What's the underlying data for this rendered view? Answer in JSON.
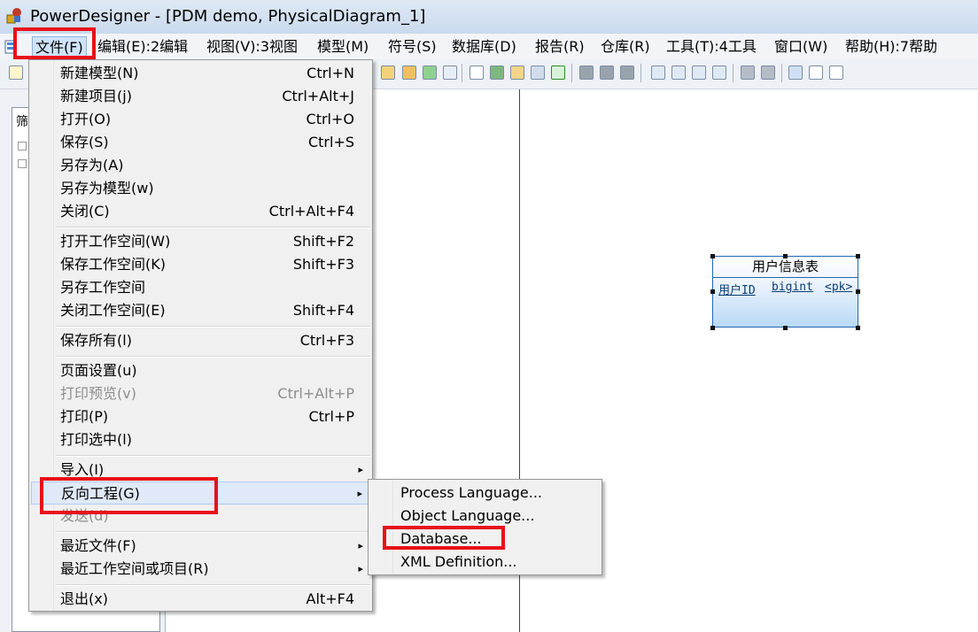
{
  "window": {
    "title": "PowerDesigner - [PDM demo, PhysicalDiagram_1]"
  },
  "menubar": {
    "items": [
      {
        "label": "文件(F)"
      },
      {
        "label": "编辑(E):2编辑"
      },
      {
        "label": "视图(V):3视图"
      },
      {
        "label": "模型(M)"
      },
      {
        "label": "符号(S)"
      },
      {
        "label": "数据库(D)"
      },
      {
        "label": "报告(R)"
      },
      {
        "label": "仓库(R)"
      },
      {
        "label": "工具(T):4工具"
      },
      {
        "label": "窗口(W)"
      },
      {
        "label": "帮助(H):7帮助"
      }
    ]
  },
  "browser": {
    "tab_label": "筛"
  },
  "file_menu": {
    "items": [
      {
        "label": "新建模型(N)",
        "shortcut": "Ctrl+N"
      },
      {
        "label": "新建项目(j)",
        "shortcut": "Ctrl+Alt+J"
      },
      {
        "label": "打开(O)",
        "shortcut": "Ctrl+O"
      },
      {
        "label": "保存(S)",
        "shortcut": "Ctrl+S"
      },
      {
        "label": "另存为(A)",
        "shortcut": ""
      },
      {
        "label": "另存为模型(w)",
        "shortcut": ""
      },
      {
        "label": "关闭(C)",
        "shortcut": "Ctrl+Alt+F4"
      },
      {
        "label": "打开工作空间(W)",
        "shortcut": "Shift+F2"
      },
      {
        "label": "保存工作空间(K)",
        "shortcut": "Shift+F3"
      },
      {
        "label": "另存工作空间",
        "shortcut": ""
      },
      {
        "label": "关闭工作空间(E)",
        "shortcut": "Shift+F4"
      },
      {
        "label": "保存所有(l)",
        "shortcut": "Ctrl+F3"
      },
      {
        "label": "页面设置(u)",
        "shortcut": ""
      },
      {
        "label": "打印预览(v)",
        "shortcut": "Ctrl+Alt+P"
      },
      {
        "label": "打印(P)",
        "shortcut": "Ctrl+P"
      },
      {
        "label": "打印选中(l)",
        "shortcut": ""
      },
      {
        "label": "导入(I)",
        "shortcut": ""
      },
      {
        "label": "反向工程(G)",
        "shortcut": ""
      },
      {
        "label": "发送(d)",
        "shortcut": ""
      },
      {
        "label": "最近文件(F)",
        "shortcut": ""
      },
      {
        "label": "最近工作空间或项目(R)",
        "shortcut": ""
      },
      {
        "label": "退出(x)",
        "shortcut": "Alt+F4"
      }
    ]
  },
  "reverse_submenu": {
    "items": [
      {
        "label": "Process Language..."
      },
      {
        "label": "Object Language..."
      },
      {
        "label": "Database..."
      },
      {
        "label": "XML Definition..."
      }
    ]
  },
  "entity": {
    "name": "用户信息表",
    "columns": [
      {
        "name": "用户ID",
        "type": "bigint",
        "key": "<pk>"
      }
    ]
  },
  "colors": {
    "highlight_box": "#e8101a",
    "entity_border": "#1f69b2",
    "menu_background": "#f0f0f0"
  },
  "icons": [
    "powerdesigner-app-icon",
    "model-icon",
    "submenu-arrow-icon",
    "toolbar-icons"
  ]
}
